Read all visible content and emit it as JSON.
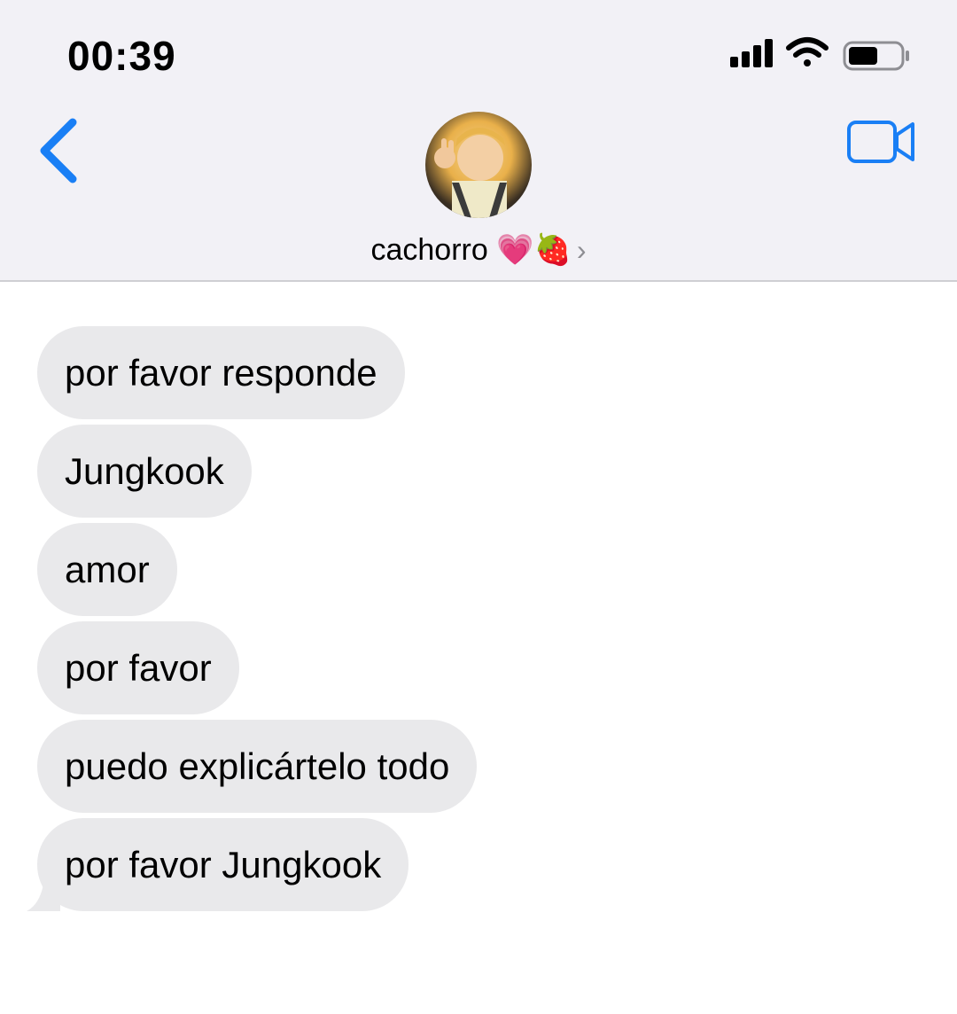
{
  "status_bar": {
    "time": "00:39",
    "signal_icon": "cellular-signal-icon",
    "wifi_icon": "wifi-icon",
    "battery_icon": "battery-icon"
  },
  "nav": {
    "back_icon": "chevron-left-icon",
    "video_icon": "video-camera-icon",
    "accent_color": "#1a7ff5"
  },
  "contact": {
    "name": "cachorro 💗🍓",
    "chevron": "›"
  },
  "messages": [
    {
      "text": "por favor responde"
    },
    {
      "text": "Jungkook"
    },
    {
      "text": "amor"
    },
    {
      "text": "por favor"
    },
    {
      "text": "puedo explicártelo todo"
    },
    {
      "text": "por favor Jungkook"
    }
  ],
  "colors": {
    "header_bg": "#f2f1f6",
    "bubble_bg": "#e9e9eb"
  }
}
